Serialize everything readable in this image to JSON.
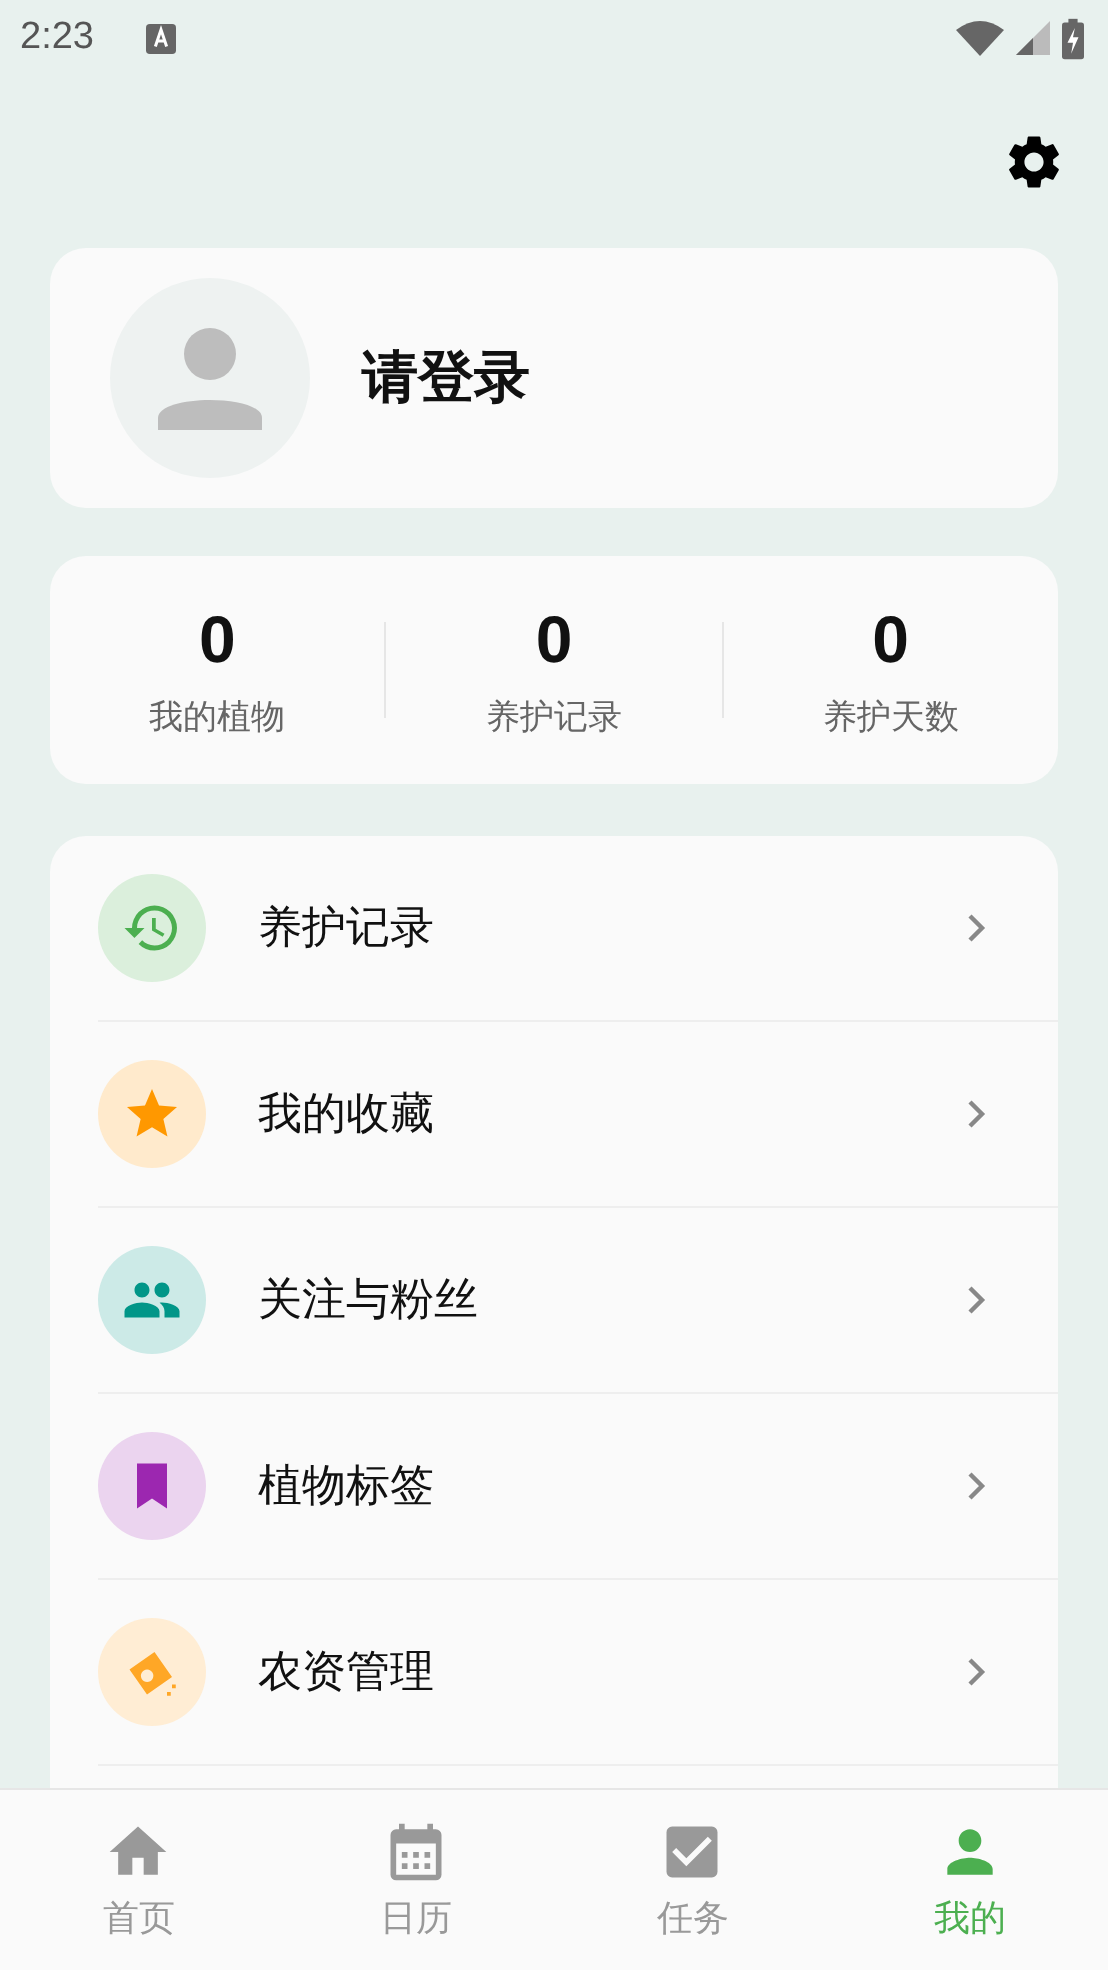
{
  "status_bar": {
    "time": "2:23"
  },
  "profile": {
    "name": "请登录"
  },
  "stats": [
    {
      "value": "0",
      "label": "我的植物"
    },
    {
      "value": "0",
      "label": "养护记录"
    },
    {
      "value": "0",
      "label": "养护天数"
    }
  ],
  "menu": [
    {
      "label": "养护记录",
      "color": "#4caf50"
    },
    {
      "label": "我的收藏",
      "color": "#ff9800"
    },
    {
      "label": "关注与粉丝",
      "color": "#009688"
    },
    {
      "label": "植物标签",
      "color": "#9c27b0"
    },
    {
      "label": "农资管理",
      "color": "#ffa726"
    }
  ],
  "bottom_nav": [
    {
      "label": "首页",
      "selected": false
    },
    {
      "label": "日历",
      "selected": false
    },
    {
      "label": "任务",
      "selected": false
    },
    {
      "label": "我的",
      "selected": true
    }
  ]
}
